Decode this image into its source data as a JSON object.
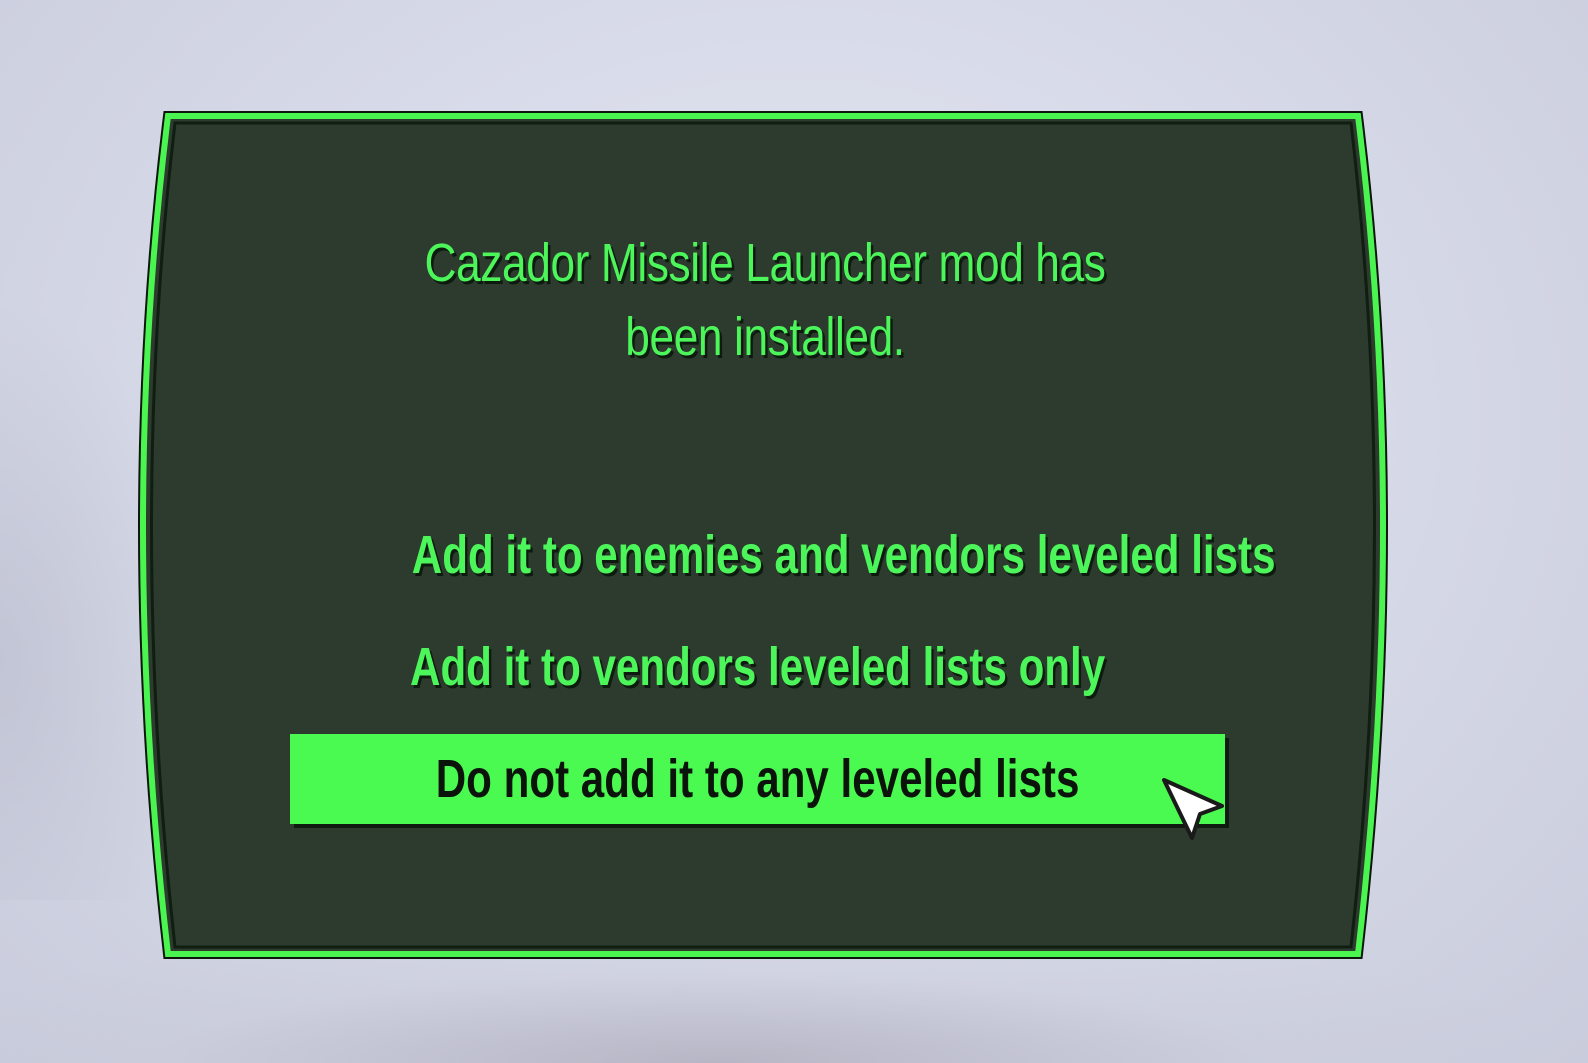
{
  "dialog": {
    "message": "Cazador Missile Launcher mod has been installed.",
    "options": [
      {
        "label": "Add it to enemies and vendors leveled lists",
        "selected": false
      },
      {
        "label": "Add it to vendors leveled lists only",
        "selected": false
      },
      {
        "label": "Do not add it to any leveled lists",
        "selected": true
      }
    ]
  },
  "colors": {
    "accent_green": "#4bfa50",
    "panel_bg": "#2e3b2f",
    "selected_text": "#0b140b"
  },
  "icons": {
    "cursor": "arrow-cursor-icon"
  }
}
